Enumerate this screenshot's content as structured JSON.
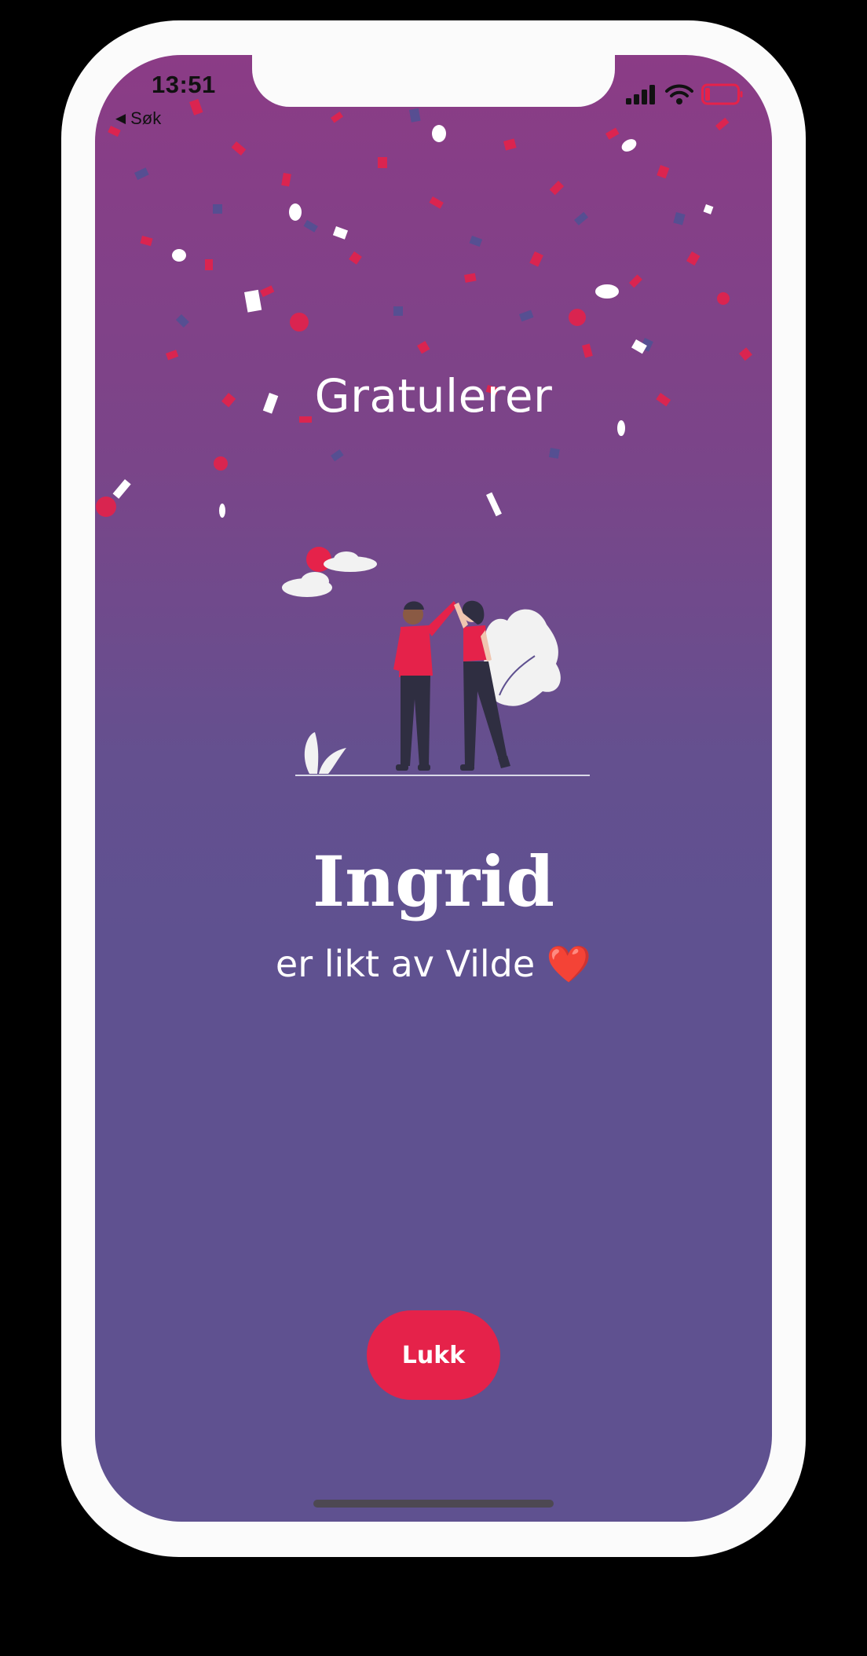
{
  "status_bar": {
    "time": "13:51",
    "back_arrow": "◀",
    "back_label": "Søk",
    "signal_icon": "cellular-signal-icon",
    "wifi_icon": "wifi-icon",
    "battery_icon": "battery-low-icon"
  },
  "main": {
    "heading": "Gratulerer",
    "name": "Ingrid",
    "liked_by": "er likt av Vilde ❤️"
  },
  "actions": {
    "close_label": "Lukk"
  },
  "colors": {
    "gradient_top": "#8b3c86",
    "gradient_bottom": "#5f5190",
    "accent": "#e5224a",
    "confetti_red": "#e5224a",
    "confetti_navy": "#4f5294",
    "confetti_white": "#ffffff"
  }
}
